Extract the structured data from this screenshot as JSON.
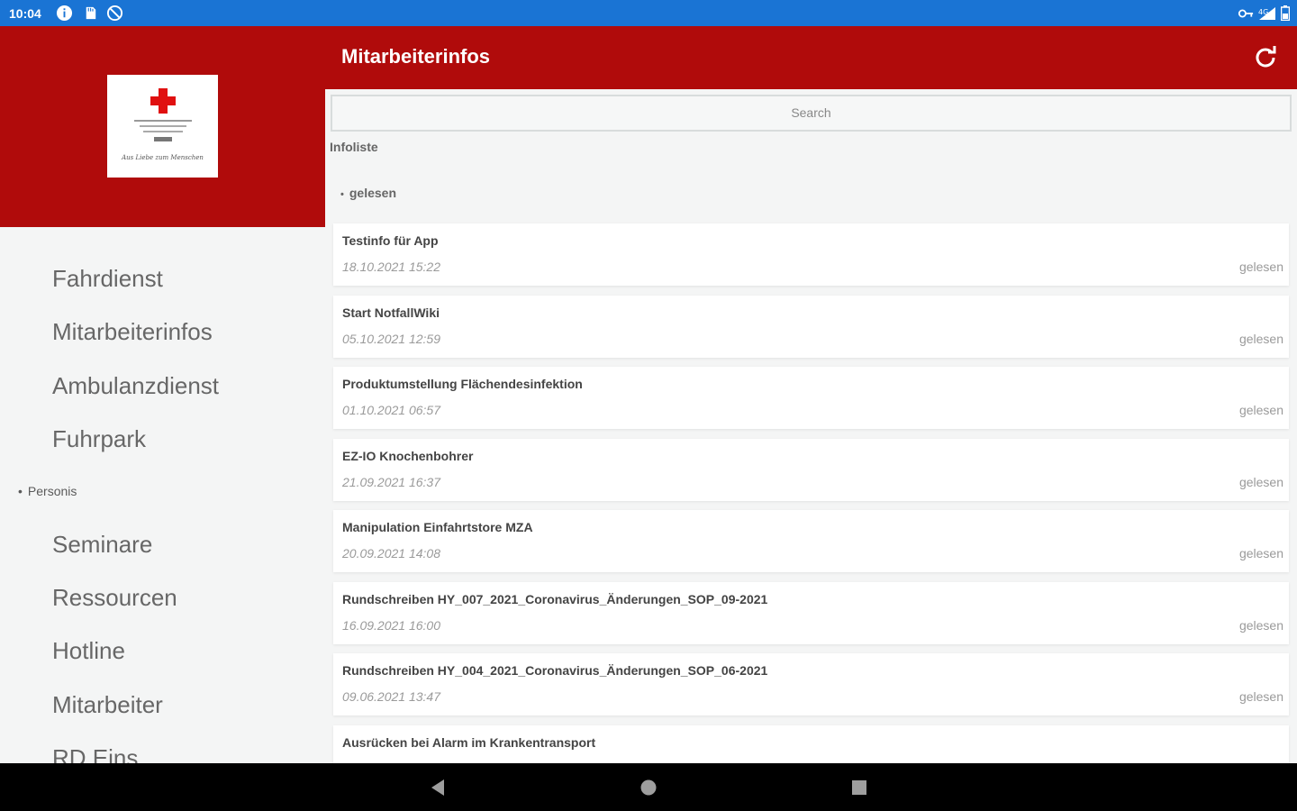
{
  "status_bar": {
    "time": "10:04",
    "left_icons": [
      "info-circle-icon",
      "sd-card-icon",
      "blocked-circle-icon"
    ],
    "right_icons": [
      "vpn-key-icon",
      "signal-icon",
      "battery-icon"
    ]
  },
  "drawer": {
    "logo": {
      "caption": "Aus Liebe zum Menschen"
    },
    "items_top": [
      "Fahrdienst",
      "Mitarbeiterinfos",
      "Ambulanzdienst",
      "Fuhrpark"
    ],
    "section": "Personis",
    "items_bottom": [
      "Seminare",
      "Ressourcen",
      "Hotline",
      "Mitarbeiter",
      "RD Eins"
    ]
  },
  "appbar": {
    "title": "Mitarbeiterinfos",
    "refresh_icon": "refresh-icon"
  },
  "main": {
    "search_placeholder": "Search",
    "section_label": "Infoliste",
    "group_header": "gelesen",
    "items": [
      {
        "title": "Testinfo für App",
        "date": "18.10.2021 15:22",
        "status": "gelesen"
      },
      {
        "title": "Start NotfallWiki",
        "date": "05.10.2021 12:59",
        "status": "gelesen"
      },
      {
        "title": "Produktumstellung Flächendesinfektion",
        "date": "01.10.2021 06:57",
        "status": "gelesen"
      },
      {
        "title": "EZ-IO Knochenbohrer",
        "date": "21.09.2021 16:37",
        "status": "gelesen"
      },
      {
        "title": "Manipulation Einfahrtstore MZA",
        "date": "20.09.2021 14:08",
        "status": "gelesen"
      },
      {
        "title": "Rundschreiben HY_007_2021_Coronavirus_Änderungen_SOP_09-2021",
        "date": "16.09.2021 16:00",
        "status": "gelesen"
      },
      {
        "title": "Rundschreiben HY_004_2021_Coronavirus_Änderungen_SOP_06-2021",
        "date": "09.06.2021 13:47",
        "status": "gelesen"
      },
      {
        "title": "Ausrücken bei Alarm im Krankentransport",
        "date": "",
        "status": ""
      }
    ]
  },
  "nav_bar": {
    "buttons": [
      "back-icon",
      "home-icon",
      "recents-icon"
    ]
  },
  "colors": {
    "brand_red": "#b00b0b",
    "status_bar_blue": "#1a74d4"
  }
}
